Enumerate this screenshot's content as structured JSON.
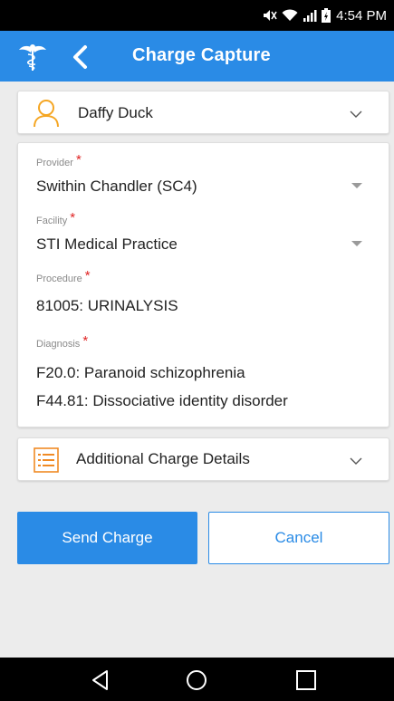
{
  "status_bar": {
    "time": "4:54 PM",
    "icons": [
      "mute-icon",
      "wifi-icon",
      "signal-icon",
      "battery-icon"
    ]
  },
  "app_bar": {
    "title": "Charge Capture",
    "logo_icon": "caduceus-icon",
    "back_icon": "chevron-left-icon",
    "color": "#2a8be6"
  },
  "patient": {
    "name": "Daffy Duck",
    "icon": "user-icon",
    "icon_color": "#f5a623"
  },
  "form": {
    "provider": {
      "label": "Provider",
      "required_mark": "*",
      "value": "Swithin Chandler (SC4)"
    },
    "facility": {
      "label": "Facility",
      "required_mark": "*",
      "value": "STI Medical Practice"
    },
    "procedure": {
      "label": "Procedure",
      "required_mark": "*",
      "value": "81005: URINALYSIS"
    },
    "diagnosis": {
      "label": "Diagnosis",
      "required_mark": "*",
      "values": [
        "F20.0: Paranoid schizophrenia",
        "F44.81: Dissociative identity disorder"
      ]
    }
  },
  "additional_details": {
    "label": "Additional Charge Details",
    "icon": "list-icon",
    "icon_color": "#f08a24"
  },
  "actions": {
    "send_label": "Send Charge",
    "cancel_label": "Cancel"
  },
  "nav_bar": {
    "icons": [
      "back-triangle-icon",
      "home-circle-icon",
      "recents-square-icon"
    ]
  }
}
